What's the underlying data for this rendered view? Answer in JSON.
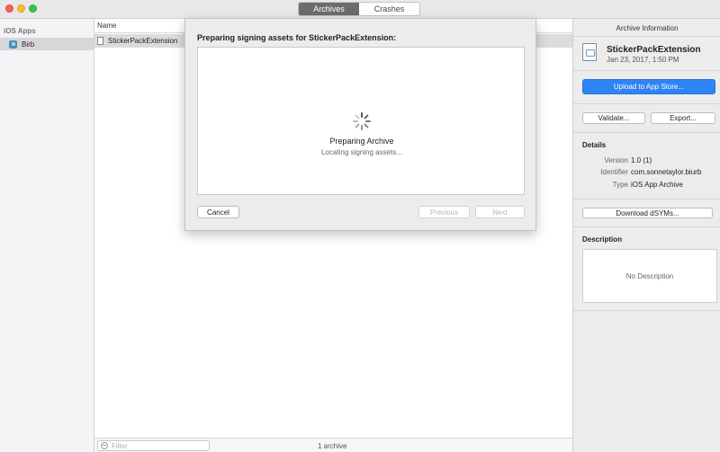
{
  "toolbar": {
    "tabs": [
      {
        "label": "Archives",
        "active": true
      },
      {
        "label": "Crashes",
        "active": false
      }
    ]
  },
  "sidebar": {
    "header": "iOS Apps",
    "items": [
      {
        "label": "Birb",
        "selected": true
      }
    ]
  },
  "list": {
    "column_name": "Name",
    "rows": [
      {
        "name": "StickerPackExtension",
        "selected": true
      }
    ],
    "filter_placeholder": "Filter",
    "count": "1 archive"
  },
  "inspector": {
    "title": "Archive Information",
    "archive_name": "StickerPackExtension",
    "archive_date": "Jan 23, 2017, 1:50 PM",
    "upload_label": "Upload to App Store...",
    "validate_label": "Validate...",
    "export_label": "Export...",
    "details_heading": "Details",
    "details": [
      {
        "key": "Version",
        "value": "1.0 (1)"
      },
      {
        "key": "Identifier",
        "value": "com.sonnetaylor.biurb"
      },
      {
        "key": "Type",
        "value": "iOS App Archive"
      }
    ],
    "dsyms_label": "Download dSYMs...",
    "description_heading": "Description",
    "description_placeholder": "No Description"
  },
  "dialog": {
    "title": "Preparing signing assets for StickerPackExtension:",
    "status": "Preparing Archive",
    "substatus": "Locating signing assets...",
    "cancel_label": "Cancel",
    "previous_label": "Previous",
    "next_label": "Next"
  },
  "colors": {
    "accent": "#2e84f5",
    "selected_tab": "#6c6c6c",
    "close": "#fc5f57",
    "minimize": "#fdbc2e",
    "maximize": "#33c748"
  }
}
